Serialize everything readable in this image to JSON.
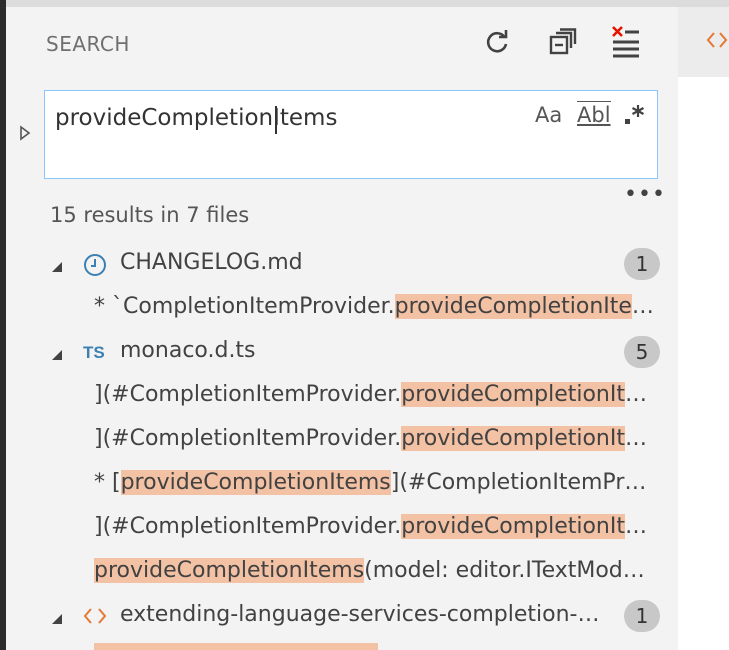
{
  "panel": {
    "title": "SEARCH"
  },
  "actions": [
    {
      "name": "refresh-icon"
    },
    {
      "name": "collapse-all-icon"
    },
    {
      "name": "clear-results-icon"
    }
  ],
  "search": {
    "value_before_caret": "provideCompletion",
    "value_after_caret": "Items",
    "option_match_case": "Aa",
    "option_whole_word": "Abl",
    "option_regex": ".*",
    "more": "•••"
  },
  "summary": "15 results in 7 files",
  "files": [
    {
      "name": "CHANGELOG.md",
      "icon": "clock-icon",
      "count": "1",
      "matches": [
        {
          "pre": "* `CompletionItemProvider.",
          "hl": "provideCompletionIte",
          "post": "…"
        }
      ]
    },
    {
      "name": "monaco.d.ts",
      "icon": "TS",
      "count": "5",
      "matches": [
        {
          "pre": "](#CompletionItemProvider.",
          "hl": "provideCompletionIt",
          "post": "…"
        },
        {
          "pre": "](#CompletionItemProvider.",
          "hl": "provideCompletionIt",
          "post": "…"
        },
        {
          "pre": "* [",
          "hl": "provideCompletionItems",
          "post": "](#CompletionItemPr…"
        },
        {
          "pre": "](#CompletionItemProvider.",
          "hl": "provideCompletionIt",
          "post": "…"
        },
        {
          "pre": "",
          "hl": "provideCompletionItems",
          "post": "(model: editor.ITextMod…"
        }
      ]
    },
    {
      "name": "extending-language-services-completion-…",
      "icon": "code-icon",
      "count": "1",
      "matches": []
    }
  ],
  "colors": {
    "accent_border": "#8cc6ff",
    "highlight": "#f3c1a3",
    "file_icon_blue": "#3c7fb1",
    "code_icon_orange": "#e37933"
  }
}
